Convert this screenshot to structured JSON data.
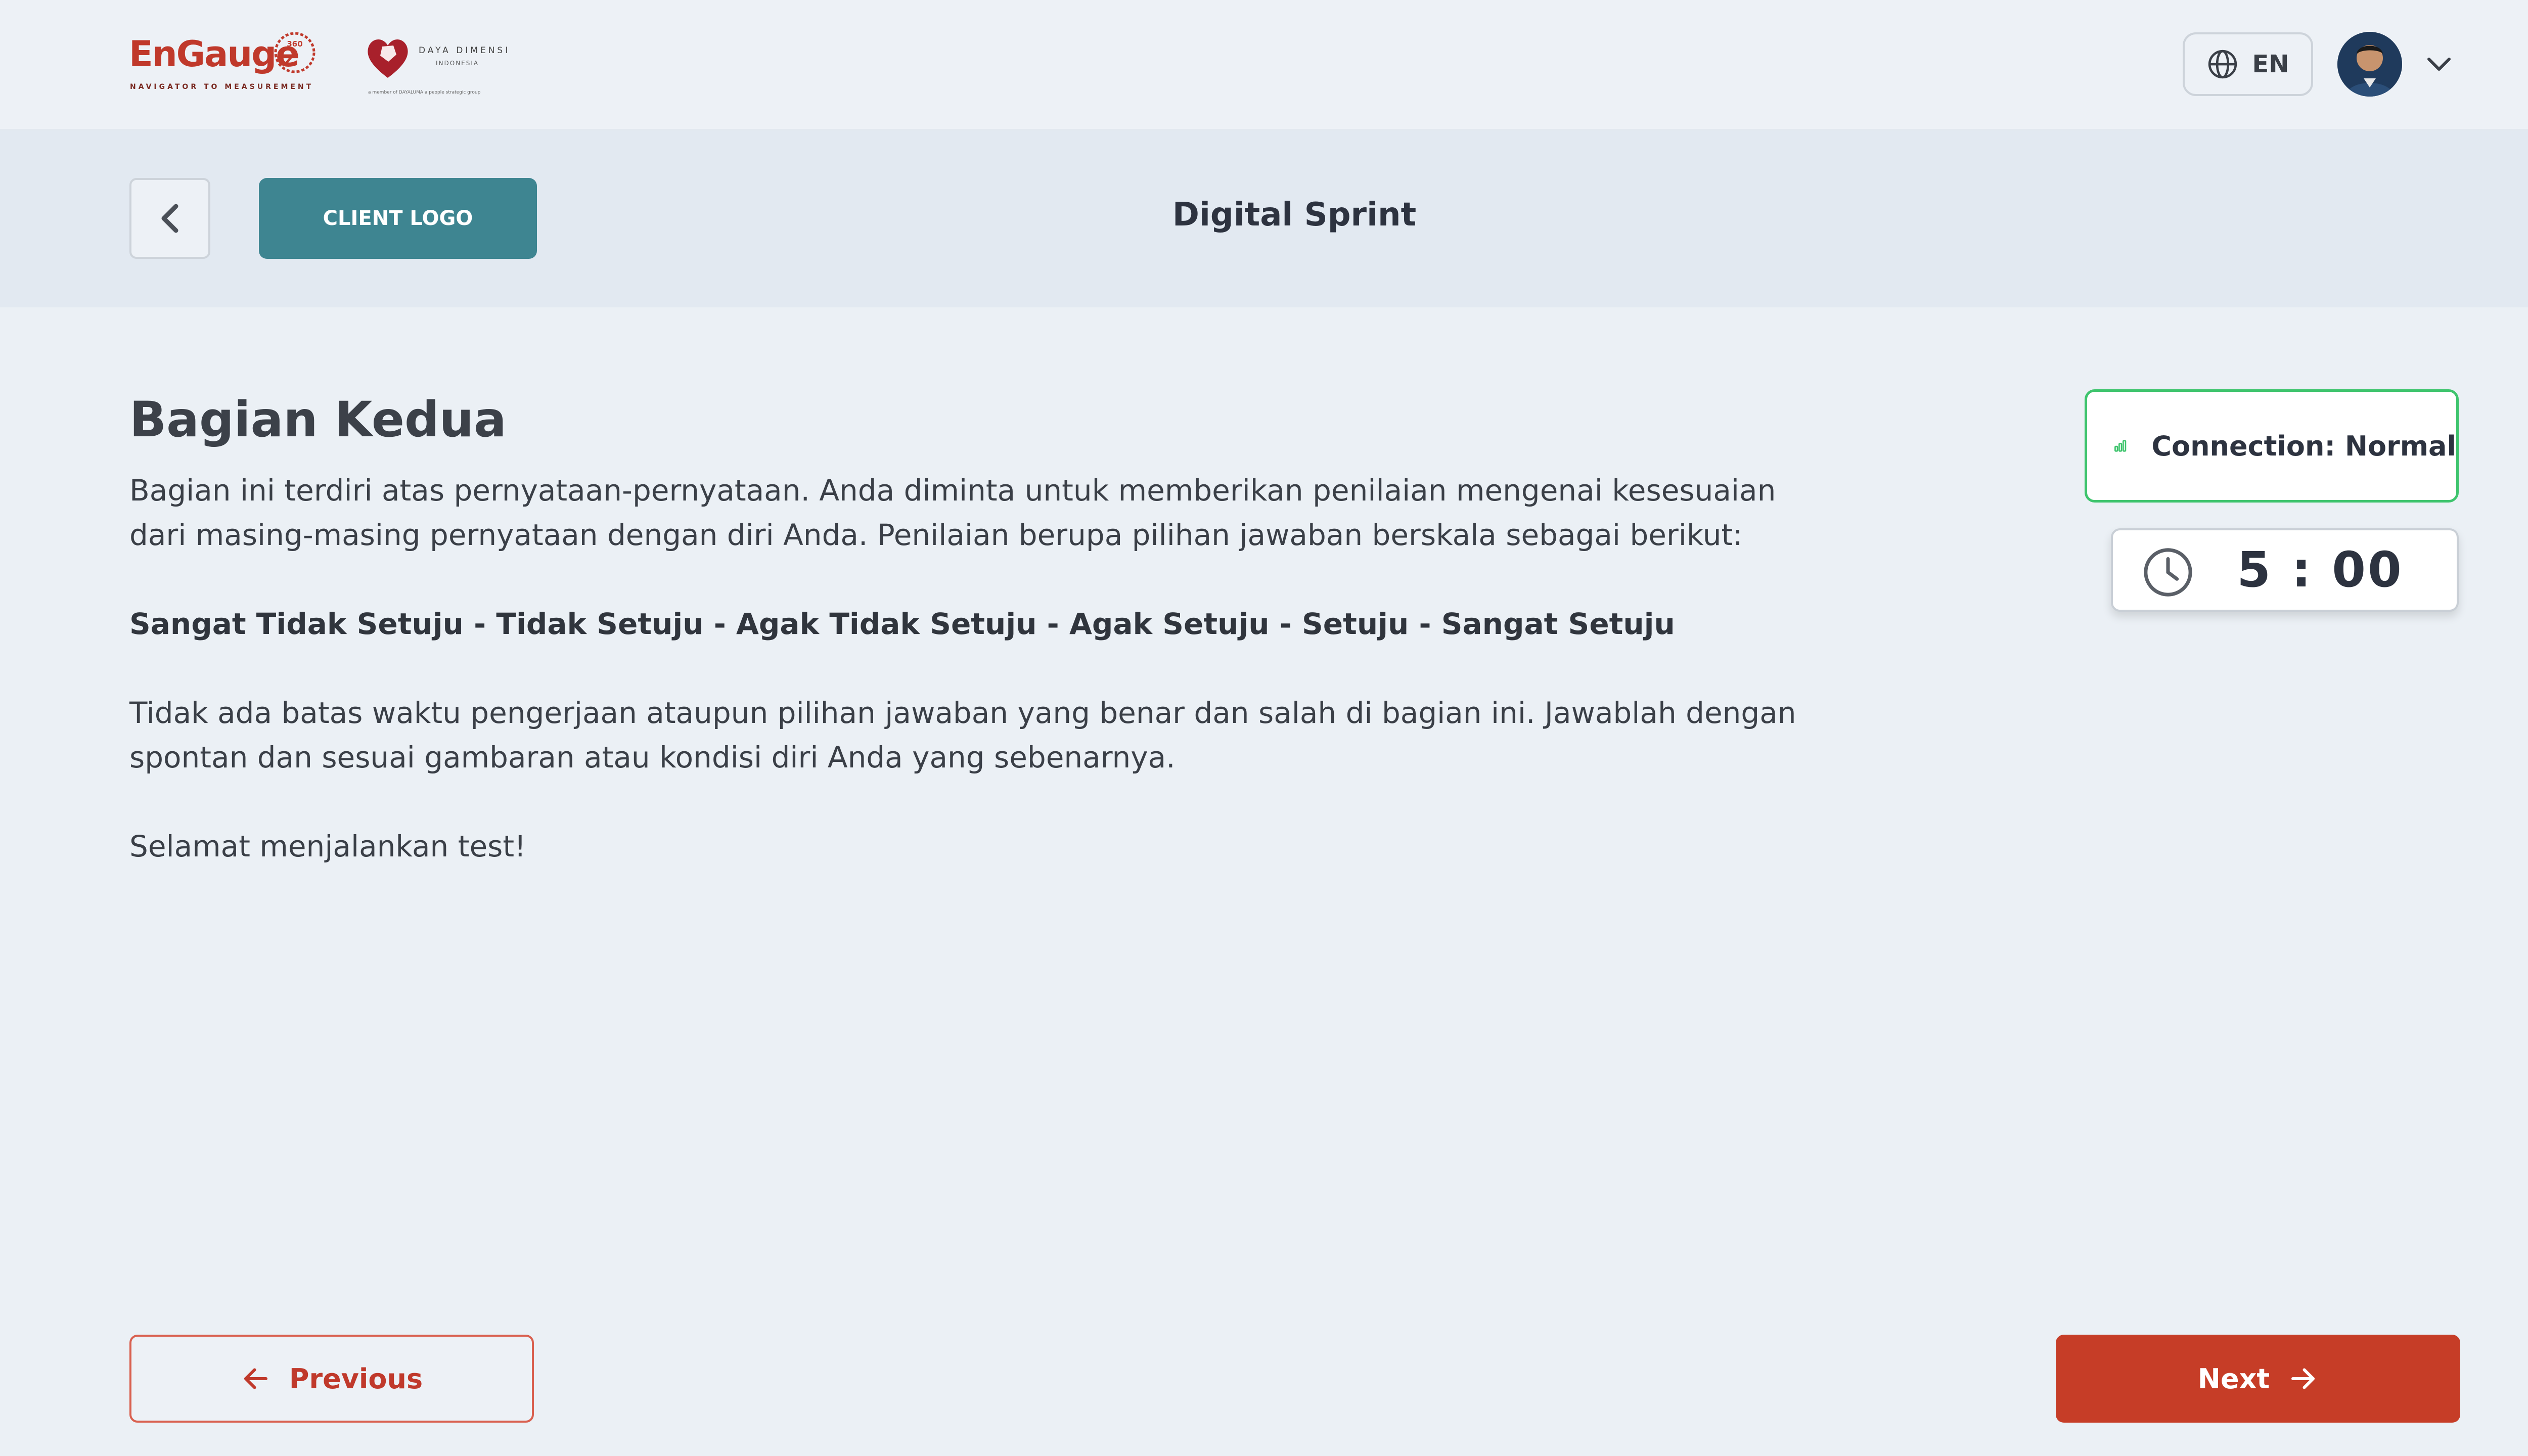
{
  "header": {
    "brand": {
      "name": "EnGauge",
      "tagline": "NAVIGATOR TO MEASUREMENT",
      "gauge_label": "360"
    },
    "partner": {
      "name": "DAYA DIMENSI",
      "sub": "INDONESIA",
      "member_text": "a member of DAYALUMA a people strategic group"
    },
    "language": {
      "label": "EN",
      "icon": "globe-icon"
    },
    "profile": {
      "avatar_icon": "user-avatar",
      "menu_icon": "chevron-down-icon"
    }
  },
  "subheader": {
    "back_icon": "chevron-left-icon",
    "client_logo_label": "CLIENT LOGO",
    "title": "Digital Sprint"
  },
  "main": {
    "section_title": "Bagian Kedua",
    "intro": "Bagian ini terdiri atas pernyataan-pernyataan. Anda diminta untuk memberikan penilaian mengenai kesesuaian dari masing-masing pernyataan dengan diri Anda. Penilaian berupa pilihan jawaban berskala sebagai berikut:",
    "scale": "Sangat Tidak Setuju - Tidak Setuju - Agak Tidak Setuju - Agak Setuju - Setuju - Sangat Setuju",
    "note": "Tidak ada batas waktu pengerjaan ataupun pilihan jawaban yang benar dan salah di bagian ini. Jawablah dengan spontan dan sesuai gambaran atau kondisi diri Anda yang sebenarnya.",
    "closing": "Selamat menjalankan test!"
  },
  "status": {
    "connection_label": "Connection: Normal",
    "connection_icon": "signal-bars-icon",
    "connection_color": "#3ec46d",
    "timer": "5 : 00",
    "timer_icon": "clock-icon"
  },
  "footer": {
    "previous_label": "Previous",
    "next_label": "Next",
    "accent_color": "#c63d27"
  }
}
